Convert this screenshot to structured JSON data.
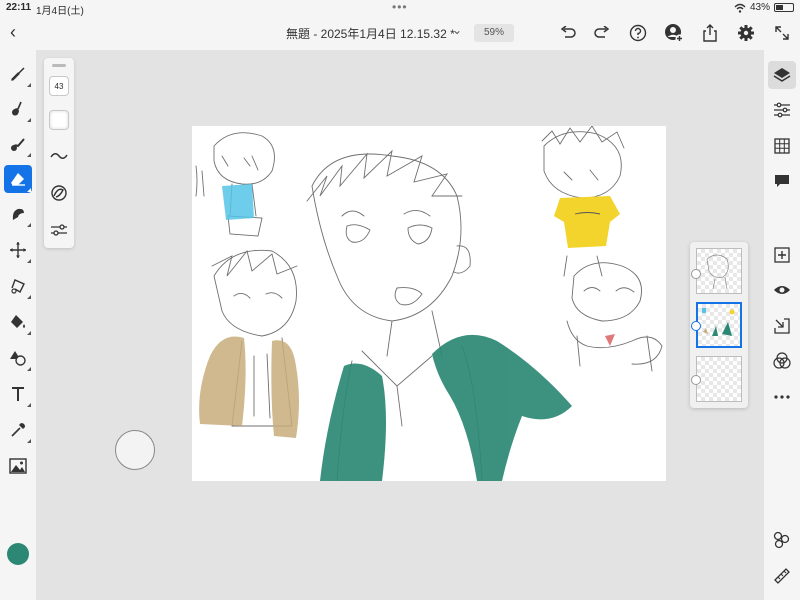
{
  "status": {
    "time": "22:11",
    "date": "1月4日(土)",
    "battery": "43%",
    "battery_level": 0.43,
    "dots": "•••"
  },
  "header": {
    "back": "‹",
    "title": "無題 - 2025年1月4日 12.15.32 *",
    "zoom": "59%"
  },
  "brush_panel": {
    "size": "43"
  },
  "toolbar": {
    "icons": [
      "brush-icon",
      "smudge-icon",
      "fill-brush-icon",
      "eraser-icon",
      "liquify-icon",
      "transform-icon",
      "lasso-icon",
      "fill-icon",
      "shape-icon",
      "text-icon",
      "eyedropper-icon",
      "image-icon"
    ],
    "active": "eraser-icon",
    "color": "#2c8874"
  },
  "right_panel": {
    "icons": [
      "layers-icon",
      "adjustments-icon",
      "grid-icon",
      "comment-icon",
      "add-layer-icon",
      "visibility-icon",
      "import-layer-icon",
      "blend-icon",
      "more-icon",
      "timelapse-icon",
      "ruler-icon"
    ]
  },
  "colors": {
    "accent": "#1473e6",
    "ink_green": "#2c8874",
    "ink_tan": "#c8ad7a",
    "ink_yellow": "#f2d42c",
    "ink_blue": "#55c4e8"
  }
}
